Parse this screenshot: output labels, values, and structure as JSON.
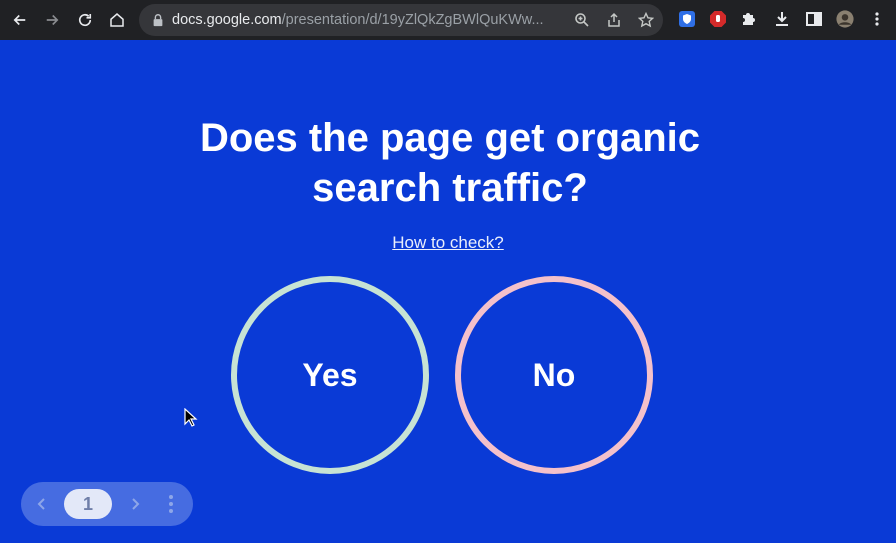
{
  "browser": {
    "url_host": "docs.google.com",
    "url_path": "/presentation/d/19yZlQkZgBWlQuKWw..."
  },
  "slide": {
    "title": "Does the page get organic search traffic?",
    "link_text": "How to check?",
    "yes_label": "Yes",
    "no_label": "No",
    "yes_color": "#c7e3d4",
    "no_color": "#f4c1cb",
    "background": "#0a3ad6"
  },
  "nav": {
    "page_number": "1"
  }
}
